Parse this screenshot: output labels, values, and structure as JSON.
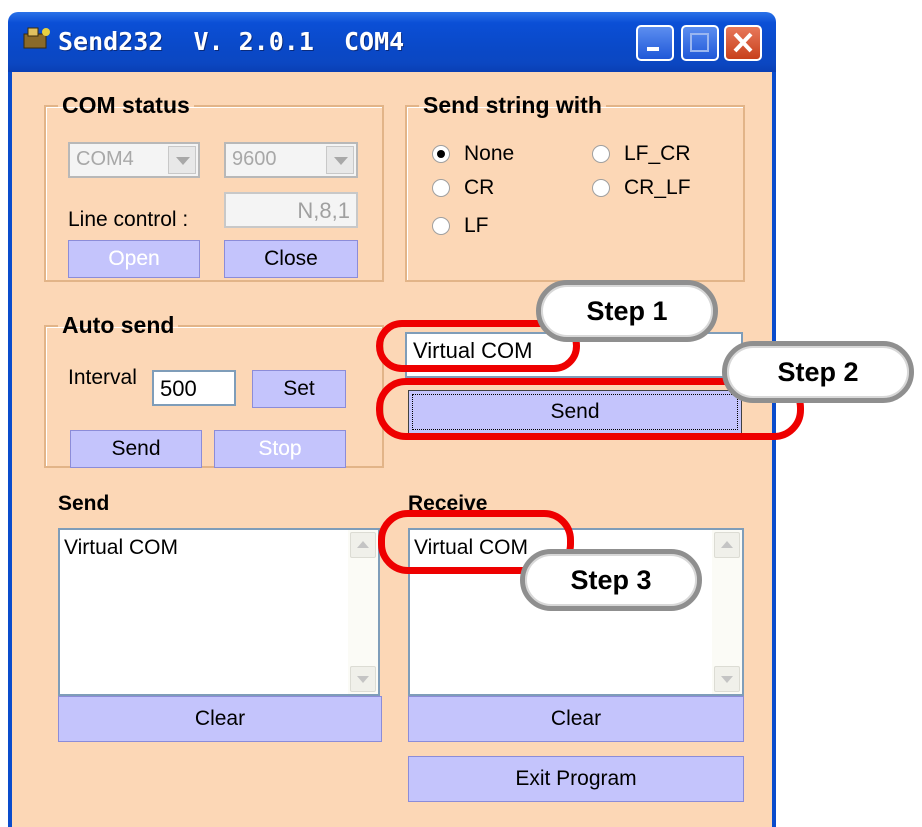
{
  "window": {
    "title": "Send232  V. 2.0.1  COM4"
  },
  "com_status": {
    "legend": "COM status",
    "port_value": "COM4",
    "baud_value": "9600",
    "line_control_label": "Line control :",
    "line_control_value": "N,8,1",
    "open_label": "Open",
    "close_label": "Close"
  },
  "send_string_with": {
    "legend": "Send string with",
    "options": [
      "None",
      "LF_CR",
      "CR",
      "CR_LF",
      "LF"
    ],
    "selected": "None"
  },
  "auto_send": {
    "legend": "Auto send",
    "interval_label": "Interval",
    "interval_value": "500",
    "set_label": "Set",
    "send_label": "Send",
    "stop_label": "Stop"
  },
  "send_input": {
    "value": "Virtual COM",
    "send_label": "Send"
  },
  "send_panel": {
    "title": "Send",
    "content": "Virtual COM",
    "clear_label": "Clear"
  },
  "receive_panel": {
    "title": "Receive",
    "content": "Virtual COM",
    "clear_label": "Clear"
  },
  "exit_label": "Exit Program",
  "annotations": {
    "step1": "Step 1",
    "step2": "Step 2",
    "step3": "Step 3"
  },
  "colors": {
    "window_bg": "#fcd7b6",
    "button": "#c4c4fc",
    "annotation_red": "#ee0000",
    "titlebar": "#0b4fd6"
  }
}
